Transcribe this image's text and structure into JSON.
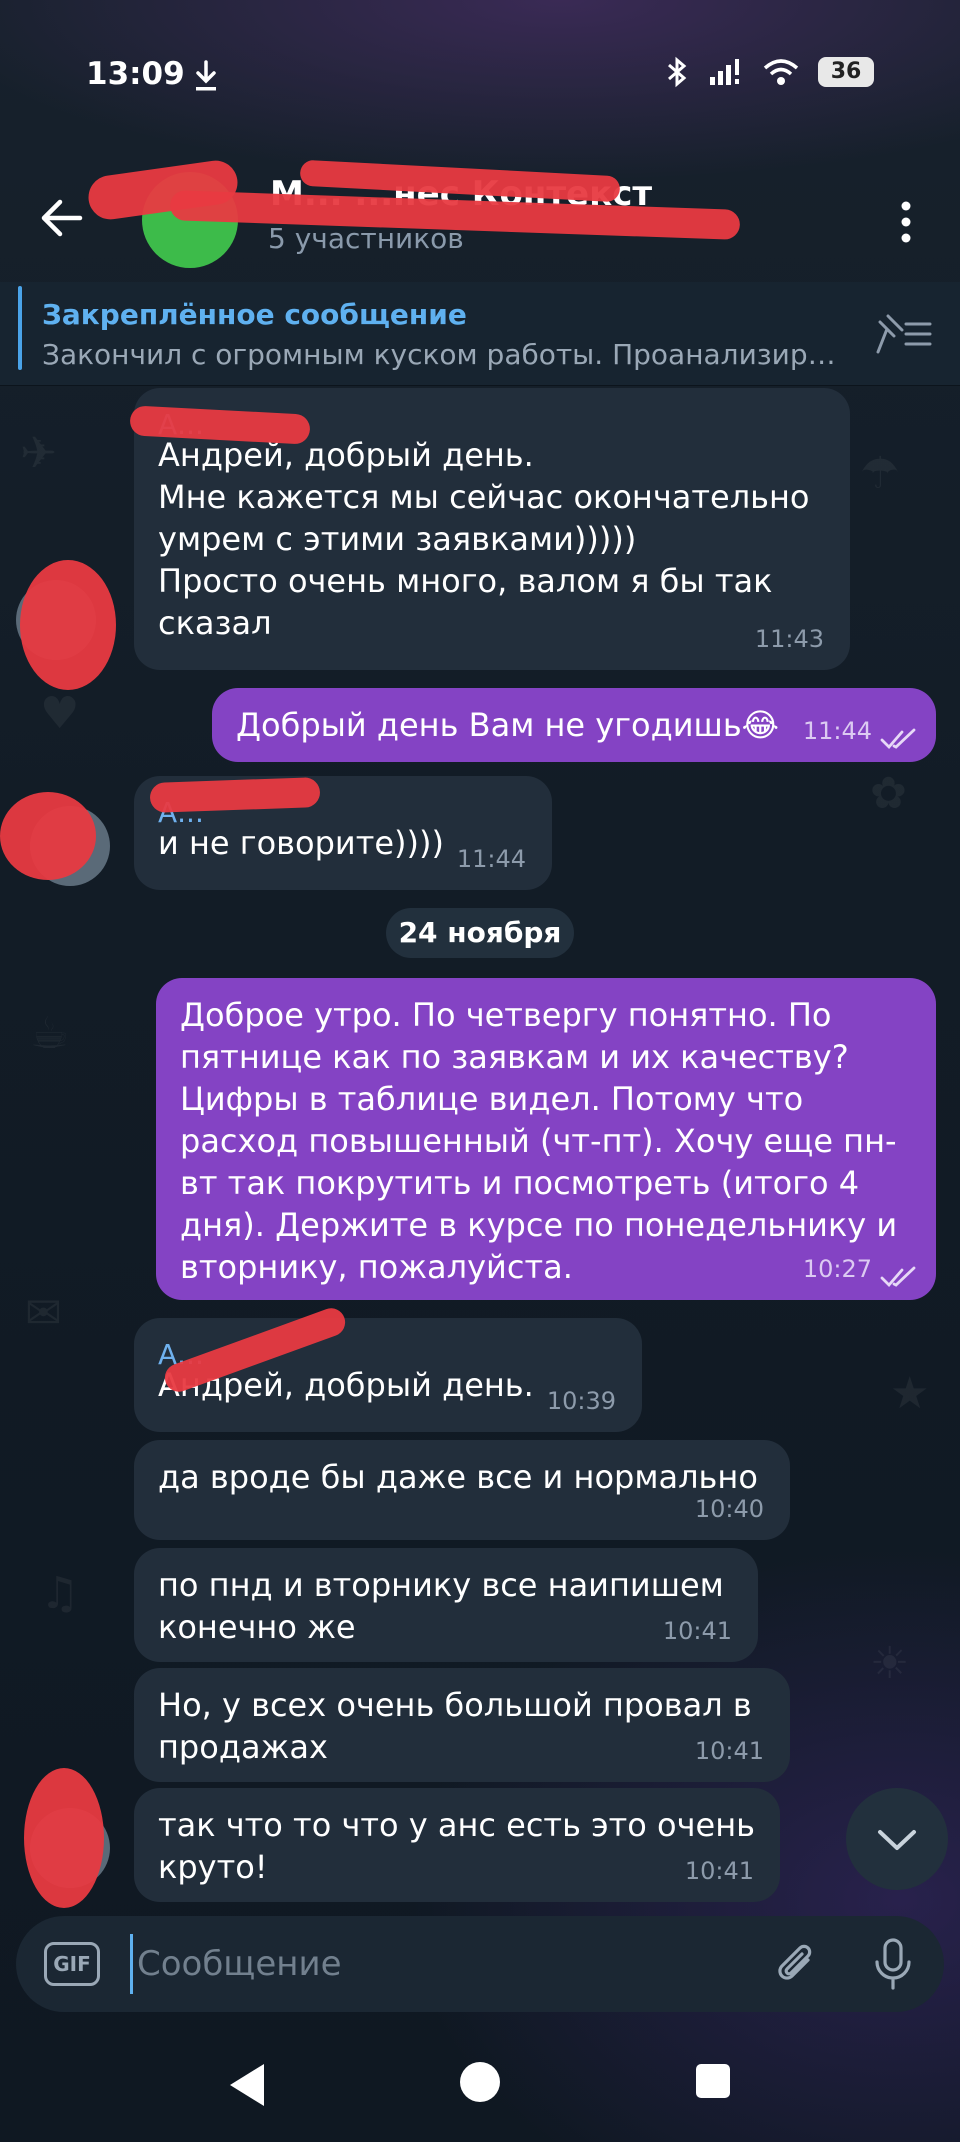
{
  "status_bar": {
    "time": "13:09",
    "battery": "36"
  },
  "header": {
    "title": "М... ...нес Контекст",
    "subtitle": "5 участников",
    "back_icon": "arrow-left-icon",
    "more_icon": "more-vertical-icon"
  },
  "pinned": {
    "title": "Закреплённое сообщение",
    "text": "Закончил с огромным куском работы. Проанализир…"
  },
  "messages": [
    {
      "sender": "А...",
      "text": "Андрей, добрый день.\nМне кажется мы сейчас окончательно умрем с этими заявками)))))\nПросто очень много, валом я бы так сказал",
      "time": "11:43"
    },
    {
      "text": "Добрый день Вам не угодишь😂",
      "time": "11:44"
    },
    {
      "sender": "А...",
      "text": "и не говорите))))",
      "time": "11:44"
    },
    {
      "text": "Доброе утро. По четвергу понятно. По пятнице как по заявкам и их качеству? Цифры в таблице видел. Потому что расход повышенный (чт-пт). Хочу еще пн-вт так покрутить и посмотреть (итого 4 дня). Держите в курсе по понедельнику и вторнику, пожалуйста.",
      "time": "10:27"
    },
    {
      "sender": "А...",
      "text": "Андрей, добрый день.",
      "time": "10:39"
    },
    {
      "text": "да вроде бы даже все и нормально",
      "time": "10:40"
    },
    {
      "text": "по пнд и вторнику все наипишем конечно же",
      "time": "10:41"
    },
    {
      "text": "Но, у всех очень большой провал в продажах",
      "time": "10:41"
    },
    {
      "text": "так что то что у анс есть это очень круто!",
      "time": "10:41"
    }
  ],
  "date_separator": "24 ноября",
  "composer": {
    "placeholder": "Сообщение",
    "gif_label": "GIF"
  },
  "colors": {
    "outgoing": "#8443c4",
    "incoming": "#222e3b",
    "accent": "#5fb1f0"
  }
}
